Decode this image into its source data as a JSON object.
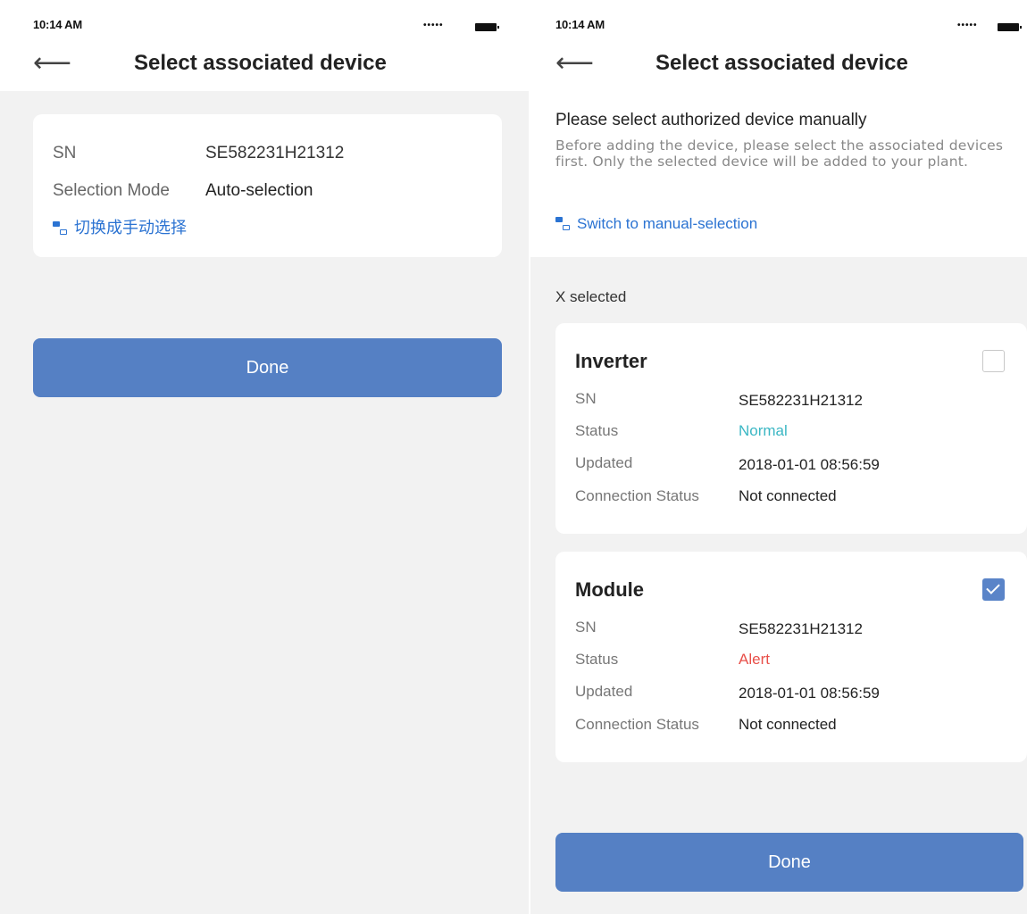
{
  "status_bar": {
    "time": "10:14 AM",
    "signal": "•••••"
  },
  "left": {
    "nav": {
      "title": "Select associated device",
      "back_icon": "arrow-left-icon"
    },
    "card": {
      "sn_label": "SN",
      "sn_value": "SE582231H21312",
      "mode_label": "Selection Mode",
      "mode_value": "Auto-selection",
      "switch_label": "切换成手动选择"
    },
    "done_label": "Done"
  },
  "right": {
    "nav": {
      "title": "Select associated device",
      "back_icon": "arrow-left-icon"
    },
    "info": {
      "title": "Please select authorized device manually",
      "description": "Before adding the device, please select the associated devices first. Only the selected device will be added to your plant.",
      "switch_label": "Switch to manual-selection"
    },
    "selected_count": "X selected",
    "devices": [
      {
        "name": "Inverter",
        "checked": false,
        "sn_label": "SN",
        "sn_value": "SE582231H21312",
        "status_label": "Status",
        "status_value": "Normal",
        "status_color": "#3bb7c4",
        "updated_label": "Updated",
        "updated_value": "2018-01-01  08:56:59",
        "conn_label": "Connection Status",
        "conn_value": "Not connected"
      },
      {
        "name": "Module",
        "checked": true,
        "sn_label": "SN",
        "sn_value": "SE582231H21312",
        "status_label": "Status",
        "status_value": "Alert",
        "status_color": "#e8504a",
        "updated_label": "Updated",
        "updated_value": "2018-01-01  08:56:59",
        "conn_label": "Connection Status",
        "conn_value": "Not connected"
      }
    ],
    "done_label": "Done"
  },
  "colors": {
    "accent": "#5580c4",
    "link": "#2b73d2",
    "background": "#f2f2f2"
  }
}
